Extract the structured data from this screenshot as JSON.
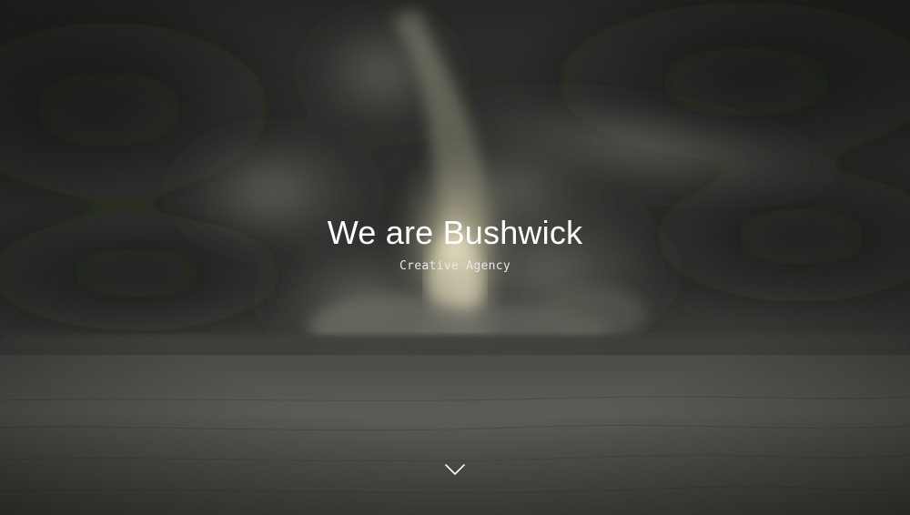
{
  "hero": {
    "title": "We are Bushwick",
    "subtitle": "Creative Agency"
  },
  "scroll_indicator": {
    "icon": "chevron-down-icon"
  },
  "colors": {
    "text": "#ffffff",
    "subtitle_text": "#e8e8e4",
    "sky_dark": "#242522",
    "ground": "#5a5b56",
    "glow": "#d9d3b0"
  }
}
